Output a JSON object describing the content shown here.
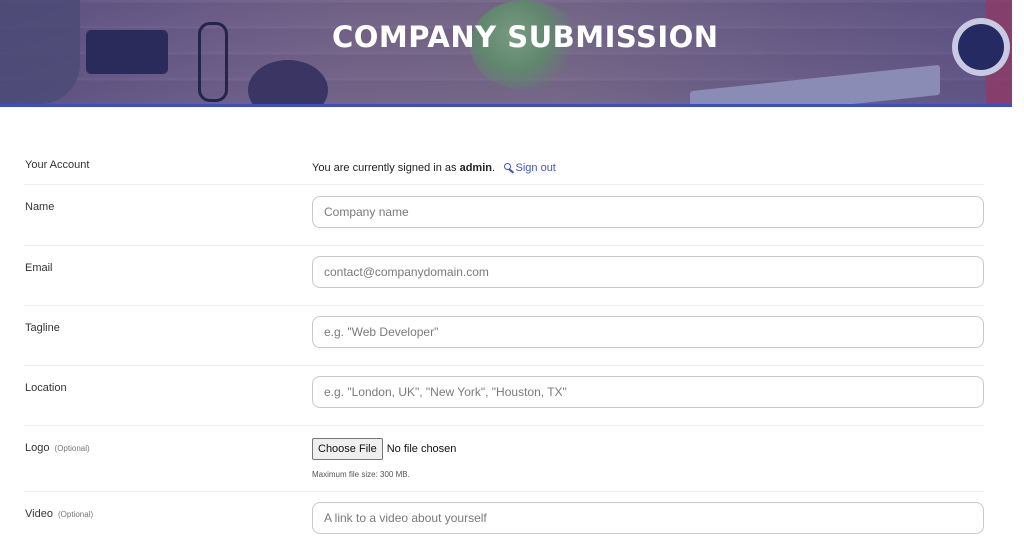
{
  "header": {
    "title": "COMPANY SUBMISSION",
    "accent_color": "#3c4fc9"
  },
  "form": {
    "account": {
      "label": "Your Account",
      "text_prefix": "You are currently signed in as",
      "username": "admin",
      "after_username": ".",
      "signout_icon": "key-icon",
      "signout_label": "Sign out"
    },
    "name": {
      "label": "Name",
      "placeholder": "Company name",
      "value": ""
    },
    "email": {
      "label": "Email",
      "placeholder": "contact@companydomain.com",
      "value": ""
    },
    "tagline": {
      "label": "Tagline",
      "placeholder": "e.g. \"Web Developer\"",
      "value": ""
    },
    "location": {
      "label": "Location",
      "placeholder": "e.g. \"London, UK\", \"New York\", \"Houston, TX\"",
      "value": ""
    },
    "logo": {
      "label": "Logo",
      "optional_label": "(Optional)",
      "button_label": "Choose File",
      "status": "No file chosen",
      "help": "Maximum file size: 300 MB."
    },
    "video": {
      "label": "Video",
      "optional_label": "(Optional)",
      "placeholder": "A link to a video about yourself",
      "value": ""
    }
  },
  "colors": {
    "link": "#3f55c8",
    "border": "#c9c9c9",
    "divider": "#ececec"
  }
}
